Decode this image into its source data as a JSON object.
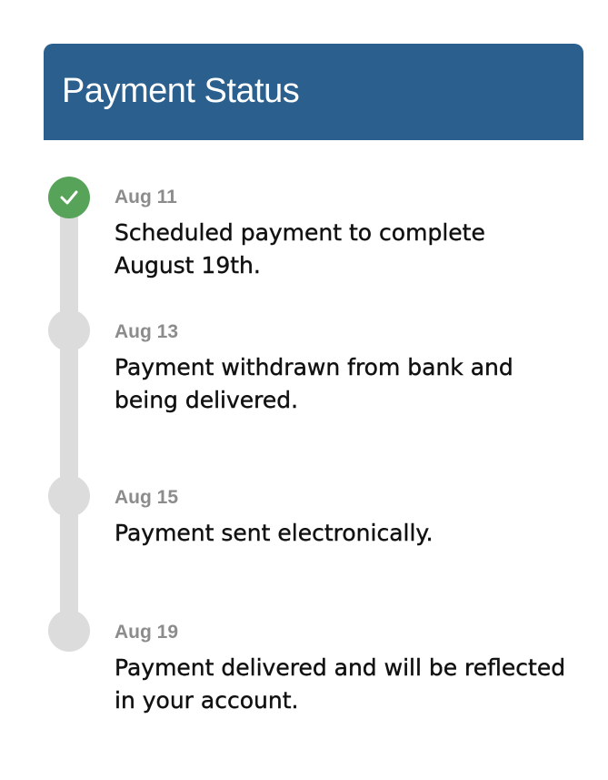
{
  "header": {
    "title": "Payment Status"
  },
  "colors": {
    "header_bg": "#2a5f8e",
    "complete": "#57a35a",
    "pending": "#dcdcdc",
    "date_text": "#8c8c8c"
  },
  "timeline": {
    "steps": [
      {
        "date": "Aug 11",
        "description": "Scheduled payment to complete August 19th.",
        "status": "complete",
        "icon": "checkmark-icon"
      },
      {
        "date": "Aug 13",
        "description": "Payment withdrawn from bank and being delivered.",
        "status": "pending"
      },
      {
        "date": "Aug 15",
        "description": "Payment sent electronically.",
        "status": "pending"
      },
      {
        "date": "Aug 19",
        "description": "Payment delivered and will be reflected in your account.",
        "status": "pending"
      }
    ]
  }
}
